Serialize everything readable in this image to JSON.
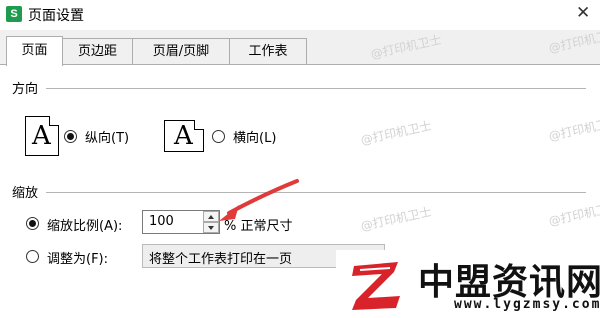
{
  "window": {
    "app_icon": "S",
    "title": "页面设置",
    "close_icon": "✕"
  },
  "tabs": [
    {
      "label": "页面",
      "active": true
    },
    {
      "label": "页边距",
      "active": false
    },
    {
      "label": "页眉/页脚",
      "active": false
    },
    {
      "label": "工作表",
      "active": false
    }
  ],
  "orientation": {
    "group_title": "方向",
    "portrait_glyph": "A",
    "landscape_glyph": "A",
    "portrait_label": "纵向(T)",
    "landscape_label": "横向(L)",
    "selected": "portrait"
  },
  "scaling": {
    "group_title": "缩放",
    "scale_label": "缩放比例(A):",
    "scale_value": "100",
    "scale_unit": "% 正常尺寸",
    "fit_label": "调整为(F):",
    "fit_value": "将整个工作表打印在一页",
    "selected": "scale"
  },
  "watermark_text": "@打印机卫士",
  "brand": {
    "name": "中盟资讯网",
    "url": "www.lygzmsy.com"
  },
  "colors": {
    "accent_arrow": "#e03a3a",
    "app_icon": "#1e9b4e"
  }
}
